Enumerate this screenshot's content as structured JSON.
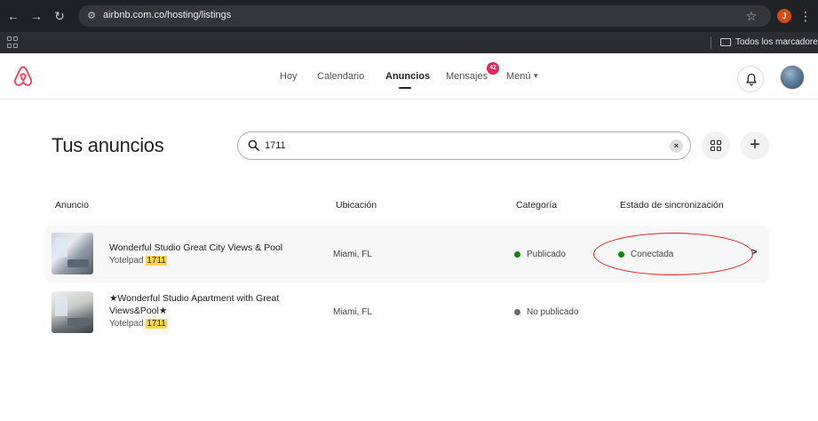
{
  "browser": {
    "url": "airbnb.com.co/hosting/listings",
    "profile_initial": "J",
    "bookmarks_label": "Todos los marcadores"
  },
  "header": {
    "nav": [
      {
        "label": "Hoy"
      },
      {
        "label": "Calendario"
      },
      {
        "label": "Anuncios"
      },
      {
        "label": "Mensajes",
        "badge": "42"
      },
      {
        "label": "Menú"
      }
    ]
  },
  "page": {
    "title": "Tus anuncios",
    "search": {
      "value": "1711"
    }
  },
  "table": {
    "columns": [
      "Anuncio",
      "Ubicación",
      "Categoría",
      "Estado de sincronización"
    ],
    "rows": [
      {
        "title": "Wonderful Studio Great City Views & Pool",
        "title_line2": "",
        "sub_prefix": "Yotelpad",
        "sub_highlight": "1711",
        "location": "Miami, FL",
        "category": "Publicado",
        "category_color": "#008a05",
        "sync_status": "Conectada",
        "sync_color": "#008a05"
      },
      {
        "title": "★Wonderful Studio Apartment with Great",
        "title_line2": "Views&Pool★",
        "sub_prefix": "Yotelpad",
        "sub_highlight": "1711",
        "location": "Miami, FL",
        "category": "No publicado",
        "category_color": "#6a6a6a",
        "sync_status": "",
        "sync_color": ""
      }
    ]
  },
  "colors": {
    "brand": "#ff385c",
    "annotation": "#e02020"
  }
}
